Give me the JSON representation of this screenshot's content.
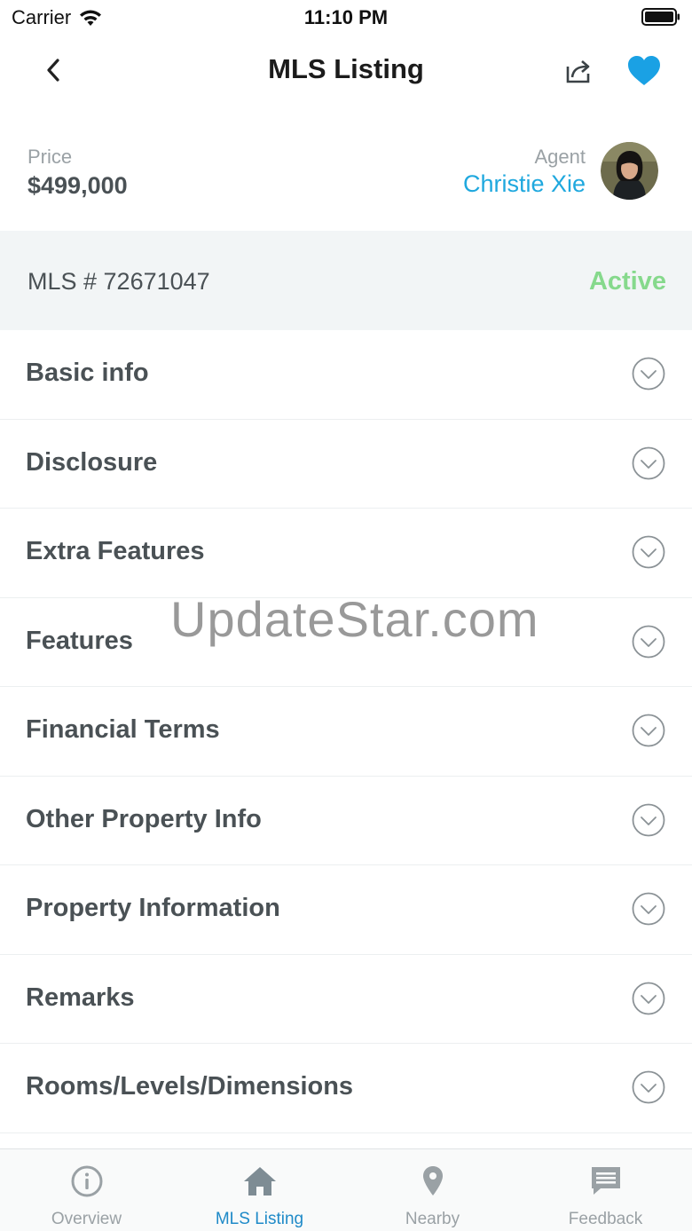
{
  "status_bar": {
    "carrier": "Carrier",
    "time": "11:10 PM"
  },
  "nav": {
    "title": "MLS Listing"
  },
  "price": {
    "label": "Price",
    "value": "$499,000"
  },
  "agent": {
    "label": "Agent",
    "name": "Christie Xie"
  },
  "mls": {
    "number": "MLS # 72671047",
    "status": "Active"
  },
  "sections": [
    {
      "label": "Basic info"
    },
    {
      "label": "Disclosure"
    },
    {
      "label": "Extra Features"
    },
    {
      "label": "Features"
    },
    {
      "label": "Financial Terms"
    },
    {
      "label": "Other Property Info"
    },
    {
      "label": "Property Information"
    },
    {
      "label": "Remarks"
    },
    {
      "label": "Rooms/Levels/Dimensions"
    }
  ],
  "watermark": "UpdateStar.com",
  "tabs": [
    {
      "label": "Overview",
      "icon": "info-icon"
    },
    {
      "label": "MLS Listing",
      "icon": "home-icon"
    },
    {
      "label": "Nearby",
      "icon": "map-pin-icon"
    },
    {
      "label": "Feedback",
      "icon": "chat-icon"
    }
  ],
  "colors": {
    "accent": "#1fa8de",
    "active_status": "#86d98c",
    "active_tab": "#1f8ac8",
    "text": "#4a5155",
    "muted": "#9aa1a5",
    "heart": "#1aa1e4"
  }
}
